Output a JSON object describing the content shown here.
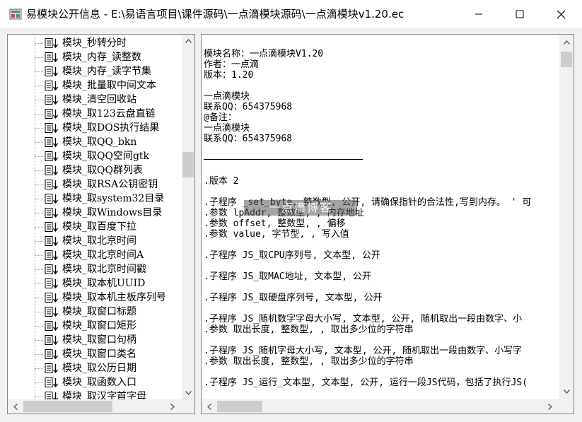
{
  "window": {
    "title": "易模块公开信息 - E:\\易语言项目\\课件源码\\一点滴模块源码\\一点滴模块v1.20.ec",
    "icon": "app-icon",
    "controls": [
      "minimize-icon",
      "maximize-icon",
      "close-icon"
    ]
  },
  "tree": {
    "items": [
      {
        "label": "模块_秒转分时"
      },
      {
        "label": "模块_内存_读整数"
      },
      {
        "label": "模块_内存_读字节集"
      },
      {
        "label": "模块_批量取中间文本"
      },
      {
        "label": "模块_清空回收站"
      },
      {
        "label": "模块_取123云盘直链"
      },
      {
        "label": "模块_取DOS执行结果"
      },
      {
        "label": "模块_取QQ_bkn"
      },
      {
        "label": "模块_取QQ空间gtk"
      },
      {
        "label": "模块_取QQ群列表"
      },
      {
        "label": "模块_取RSA公钥密钥"
      },
      {
        "label": "模块_取system32目录"
      },
      {
        "label": "模块_取Windows目录"
      },
      {
        "label": "模块_取百度下拉"
      },
      {
        "label": "模块_取北京时间"
      },
      {
        "label": "模块_取北京时间A"
      },
      {
        "label": "模块_取北京时间戳"
      },
      {
        "label": "模块_取本机UUID"
      },
      {
        "label": "模块_取本机主板序列号"
      },
      {
        "label": "模块_取窗口标题"
      },
      {
        "label": "模块_取窗口矩形"
      },
      {
        "label": "模块_取窗口句柄"
      },
      {
        "label": "模块_取窗口类名"
      },
      {
        "label": "模块_取公历日期"
      },
      {
        "label": "模块_取函数入口"
      },
      {
        "label": "模块_取汉字首字母"
      }
    ],
    "item_icon": "function-doc-icon"
  },
  "code": {
    "lines": [
      "模块名称：一点滴模块V1.20",
      "作者：一点滴",
      "版本：1.20",
      "",
      "一点滴模块",
      "联系QQ：654375968",
      "@备注：",
      "一点滴模块",
      "联系QQ：654375968",
      "",
      "",
      "",
      ".版本 2",
      "",
      ".子程序 _set_byte, 整数型, 公开, 请确保指针的合法性,写到内存。 ' 可",
      ".参数 lpAddr, 整数型, , 内存地址",
      ".参数 offset, 整数型, , 偏移",
      ".参数 value, 字节型, , 写入值",
      "",
      ".子程序 JS_取CPU序列号, 文本型, 公开",
      "",
      ".子程序 JS_取MAC地址, 文本型, 公开",
      "",
      ".子程序 JS_取硬盘序列号, 文本型, 公开",
      "",
      ".子程序 JS_随机数字字母大小写, 文本型, 公开, 随机取出一段由数字、小",
      ".参数 取出长度, 整数型, , 取出多少位的字符串",
      "",
      ".子程序 JS_随机字母大小写, 文本型, 公开, 随机取出一段由数字、小写字",
      ".参数 取出长度, 整数型, , 取出多少位的字符串",
      "",
      ".子程序 JS_运行_文本型, 文本型, 公开, 运行一段JS代码，包括了执行JS("
    ],
    "watermark": "一点滴博客"
  },
  "colors": {
    "title_bg": "#ffffff",
    "client_bg": "#f0f0f0",
    "pane_border": "#828790",
    "scrollbar_thumb": "#cdcdcd",
    "text": "#000000"
  }
}
